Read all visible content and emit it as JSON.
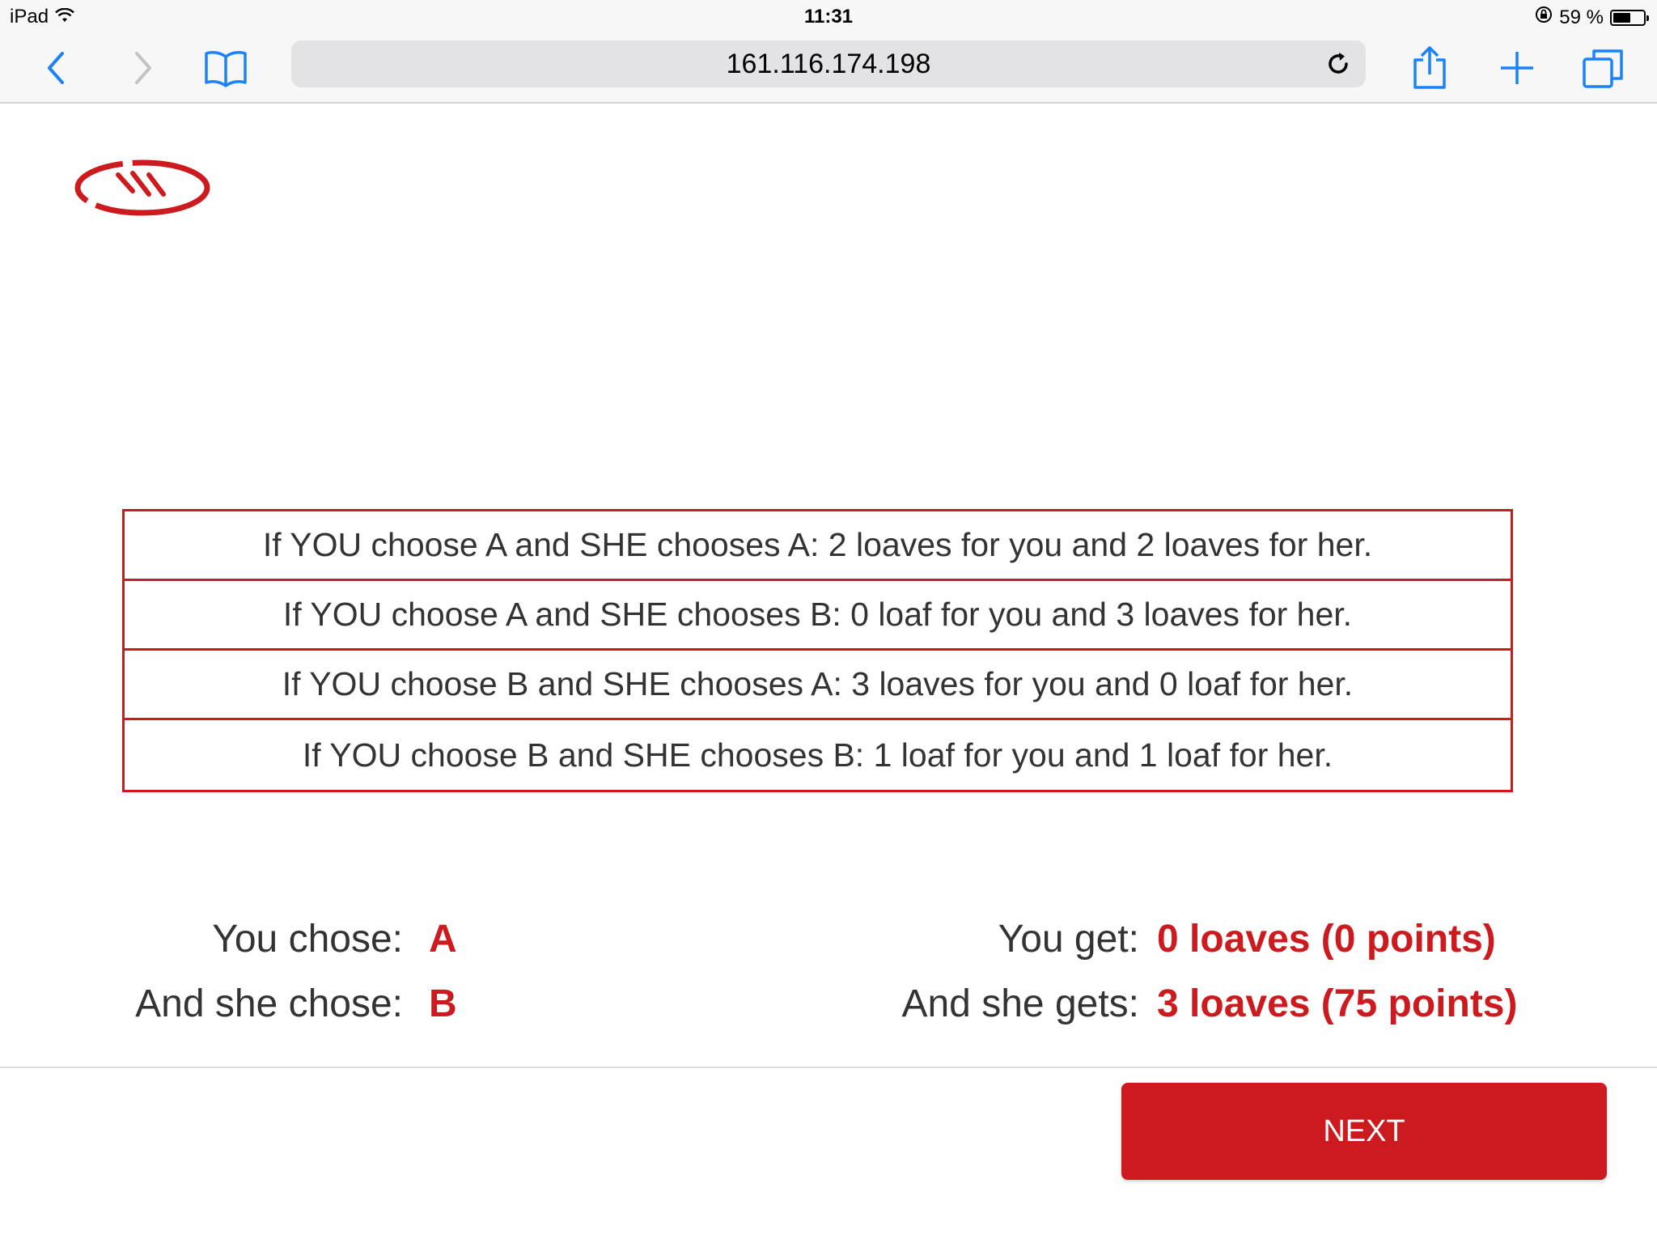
{
  "status_bar": {
    "device": "iPad",
    "time": "11:31",
    "battery_percent_text": "59 %",
    "battery_level": 0.59
  },
  "browser": {
    "url": "161.116.174.198",
    "icons": [
      "back-icon",
      "forward-icon",
      "bookmarks-icon",
      "reload-icon",
      "share-icon",
      "new-tab-icon",
      "tabs-icon"
    ]
  },
  "payoffs": {
    "rows": [
      "If YOU choose A and SHE chooses A: 2 loaves for you and 2 loaves for her.",
      "If YOU choose A and SHE chooses B: 0 loaf for you and 3 loaves for her.",
      "If YOU choose B and SHE chooses A: 3 loaves for you and 0 loaf for her.",
      "If YOU choose B and SHE chooses B: 1 loaf for you and 1 loaf for her."
    ]
  },
  "results": {
    "you_chose_label": "You chose:",
    "you_chose_value": "A",
    "she_chose_label": "And she chose:",
    "she_chose_value": "B",
    "you_get_label": "You get:",
    "you_get_value": "0 loaves (0 points)",
    "she_gets_label": "And she gets:",
    "she_gets_value": "3 loaves (75 points)"
  },
  "actions": {
    "next_label": "NEXT"
  },
  "colors": {
    "accent": "#cc1a1e",
    "ios_blue": "#1a82fb"
  }
}
